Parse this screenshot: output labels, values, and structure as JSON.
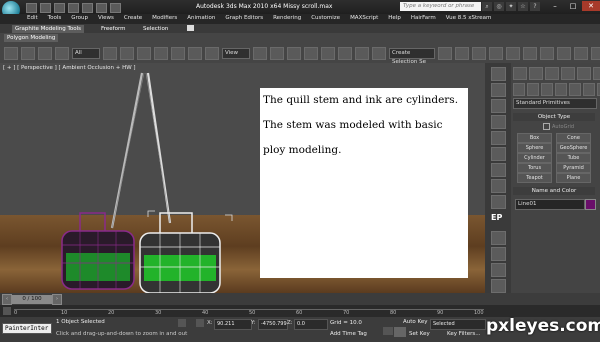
{
  "window": {
    "title": "Autodesk 3ds Max  2010 x64     Missy scroll.max",
    "search_placeholder": "Type a keyword or phrase"
  },
  "menu": [
    "Edit",
    "Tools",
    "Group",
    "Views",
    "Create",
    "Modifiers",
    "Animation",
    "Graph Editors",
    "Rendering",
    "Customize",
    "MAXScript",
    "Help",
    "HairFarm",
    "Vue 8.5 xStream"
  ],
  "ribbon": {
    "tabs": [
      "Graphite Modeling Tools",
      "Freeform",
      "Selection"
    ],
    "panel": "Polygon Modeling"
  },
  "toolbar": {
    "filter_value": "All",
    "ref_coord_value": "View",
    "selection_set_value": "Create Selection Se"
  },
  "viewport": {
    "label": "[ + ] [ Perspective ] [ Ambient Occlusion + HW ]",
    "text_lines": [
      "The quill stem and ink are cylinders.",
      "The stem was modeled with basic",
      "ploy modeling."
    ]
  },
  "command_panel": {
    "category_value": "Standard Primitives",
    "object_type_title": "Object Type",
    "autogrid_label": "AutoGrid",
    "object_buttons": [
      "Box",
      "Cone",
      "Sphere",
      "GeoSphere",
      "Cylinder",
      "Tube",
      "Torus",
      "Pyramid",
      "Teapot",
      "Plane"
    ],
    "name_color_title": "Name and Color",
    "name_value": "Line01",
    "object_color": "#6a0f6a",
    "side_label": "EP"
  },
  "timeline": {
    "frame_readout": "0 / 100",
    "ticks": [
      "0",
      "10",
      "20",
      "30",
      "40",
      "50",
      "60",
      "70",
      "80",
      "90",
      "100"
    ]
  },
  "status": {
    "script_label": "PainterInter",
    "selection_text": "1 Object Selected",
    "prompt_text": "Click and drag-up-and-down to zoom in and out",
    "x_label": "X:",
    "x_value": "90.211",
    "y_label": "Y:",
    "y_value": "-4750.799",
    "z_label": "Z:",
    "z_value": "0.0",
    "grid_text": "Grid = 10.0",
    "add_time_tag": "Add Time Tag",
    "auto_key": "Auto Key",
    "set_key": "Set Key",
    "key_mode_value": "Selected",
    "key_filters": "Key Filters..."
  },
  "watermark": "pxleyes.com"
}
